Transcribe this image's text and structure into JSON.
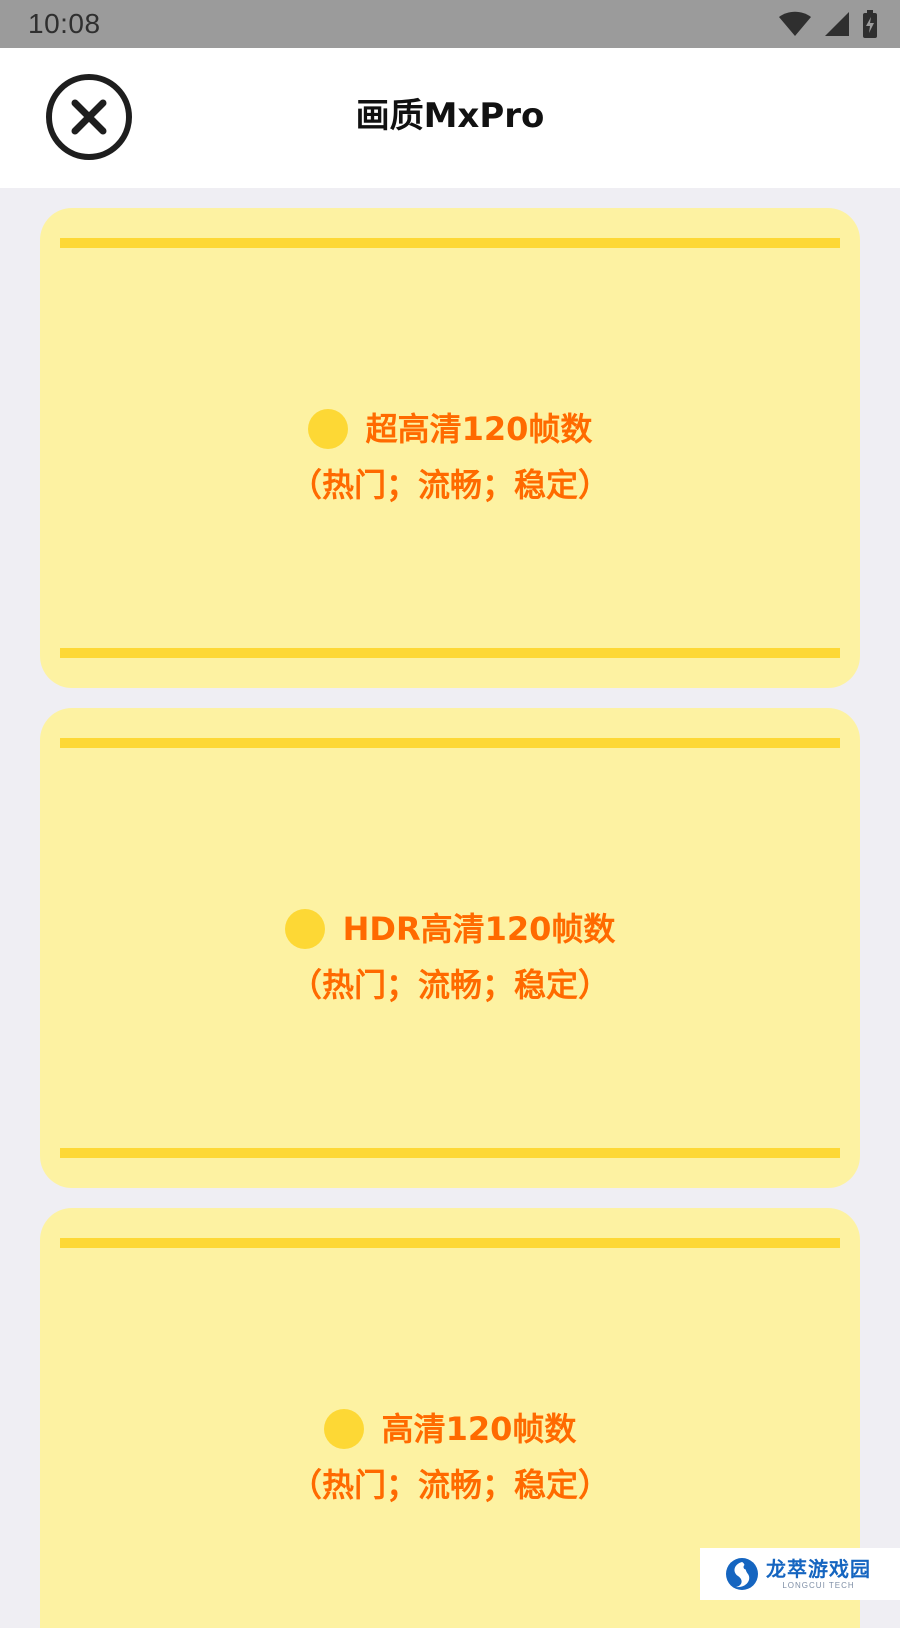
{
  "status_bar": {
    "time": "10:08",
    "icons": [
      "wifi-icon",
      "cellular-signal-icon",
      "battery-icon"
    ]
  },
  "header": {
    "title": "画质MxPro",
    "close_icon": "close-icon"
  },
  "options": [
    {
      "title": "超高清120帧数",
      "description": "（热门；流畅；稳定）"
    },
    {
      "title": "HDR高清120帧数",
      "description": "（热门；流畅；稳定）"
    },
    {
      "title": "高清120帧数",
      "description": "（热门；流畅；稳定）"
    }
  ],
  "watermark": {
    "name": "龙萃游戏园",
    "subtitle": "LONGCUI TECH"
  },
  "colors": {
    "status_bar": "#9b9b9b",
    "page_background": "#efeef3",
    "card_background": "#fdf2a2",
    "accent_yellow": "#fdd835",
    "option_text": "#ff6a00"
  }
}
